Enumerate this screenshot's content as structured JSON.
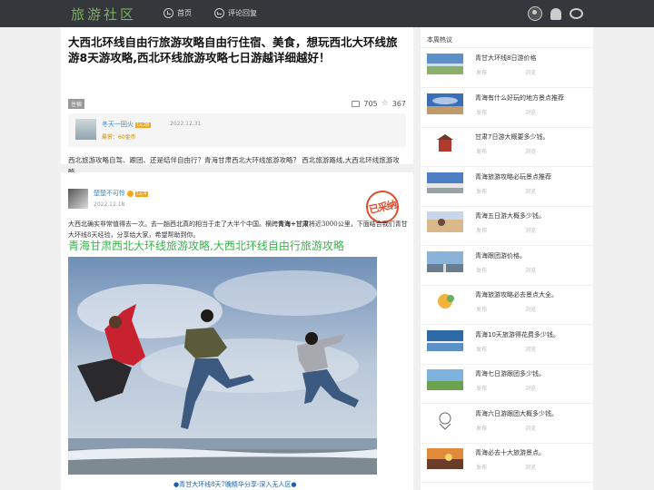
{
  "header": {
    "logo": "旅游社区",
    "nav_home": "首页",
    "nav_reply": "评论回复"
  },
  "question": {
    "title": "大西北环线自由行旅游攻略自由行住宿、美食，想玩西北大环线旅游8天游攻略,西北环线旅游攻略七日游越详细越好！",
    "tag": "住宿",
    "comments": "705",
    "favorites": "367",
    "asker_name": "冬天一回火",
    "asker_level": "Lv.26",
    "asker_date": "2022.12.31",
    "reward": "悬赏：60金币",
    "description": "西北旅游攻略自驾、跟团、还是结伴自由行？青海甘肃西北大环线旅游攻略？ 西北旅游路线,大西北环线旅游攻略"
  },
  "answer": {
    "name": "楚楚不可怜",
    "level": "Lv.4",
    "date": "2022.12.18",
    "stamp": "已采纳",
    "body_pre": "大西北确实非常值得去一次。去一趟西北真的相当于走了大半个中国。横跨",
    "body_bold": "青海+甘肃",
    "body_post": "将近3000公里，下面结合我们青甘大环线8天经验，分享给大家，希望帮助到你。",
    "heading": "青海甘肃西北大环线旅游攻略,大西北环线自由行旅游攻略",
    "caption": "●青甘大环线8天7晚精华分享-深入无人区●"
  },
  "sidebar": {
    "title": "本周热议",
    "items": [
      {
        "title": "青甘大环线8日游价格",
        "m1": "发布",
        "m2": "浏览",
        "thumb": "lake"
      },
      {
        "title": "青海有什么好玩的地方景点推荐",
        "m1": "发布",
        "m2": "浏览",
        "thumb": "sky"
      },
      {
        "title": "甘肃7日游大概要多少钱。",
        "m1": "发布",
        "m2": "浏览",
        "thumb": "building"
      },
      {
        "title": "青海旅游攻略必玩景点推荐",
        "m1": "发布",
        "m2": "浏览",
        "thumb": "lake2"
      },
      {
        "title": "青海五日游大概多少钱。",
        "m1": "发布",
        "m2": "浏览",
        "thumb": "camel"
      },
      {
        "title": "青海跟团游价格。",
        "m1": "发布",
        "m2": "浏览",
        "thumb": "road"
      },
      {
        "title": "青海旅游攻略必去景点大全。",
        "m1": "发布",
        "m2": "浏览",
        "thumb": "cartoon"
      },
      {
        "title": "青海10天旅游得花费多少钱。",
        "m1": "发布",
        "m2": "浏览",
        "thumb": "water"
      },
      {
        "title": "青海七日游跟团多少钱。",
        "m1": "发布",
        "m2": "浏览",
        "thumb": "grass"
      },
      {
        "title": "青海六日游跟团大概多少钱。",
        "m1": "发布",
        "m2": "浏览",
        "thumb": "sketch"
      },
      {
        "title": "青海必去十大旅游景点。",
        "m1": "发布",
        "m2": "浏览",
        "thumb": "sunset"
      }
    ]
  }
}
